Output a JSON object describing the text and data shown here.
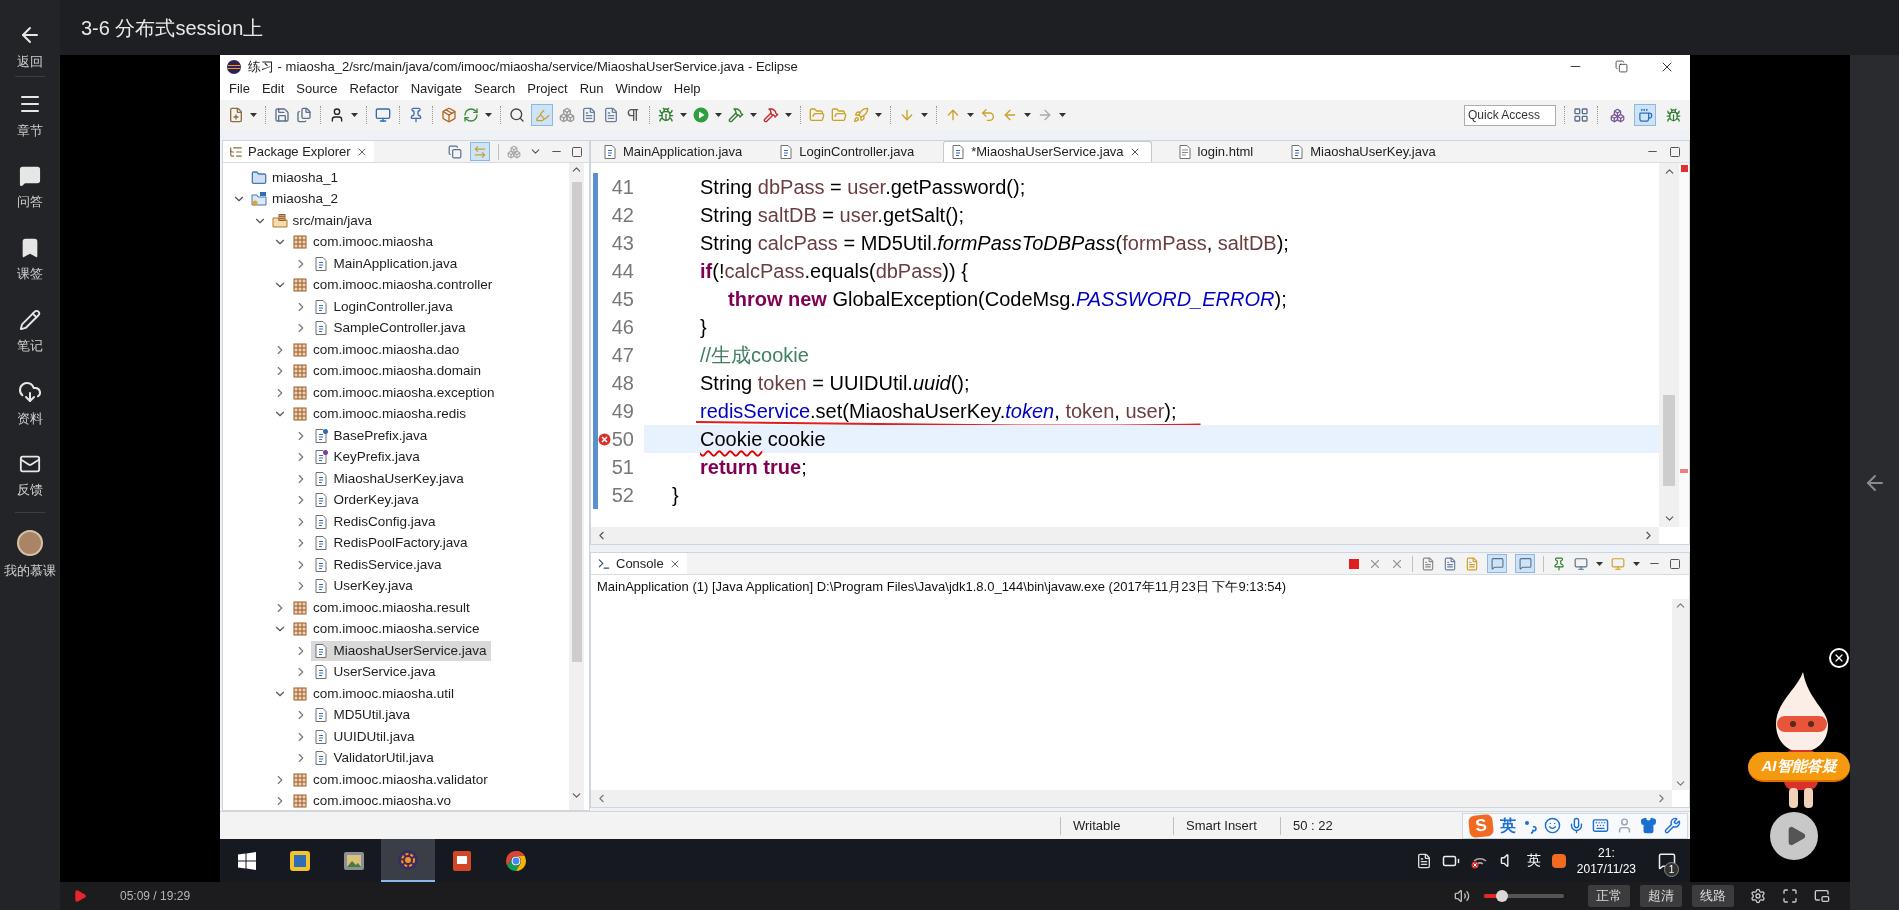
{
  "sidebar": {
    "items": [
      {
        "kind": "back",
        "label": "返回"
      },
      {
        "kind": "chapters",
        "label": "章节"
      },
      {
        "kind": "qa",
        "label": "问答"
      },
      {
        "kind": "bookmark",
        "label": "课签"
      },
      {
        "kind": "notes",
        "label": "笔记"
      },
      {
        "kind": "downloads",
        "label": "资料"
      },
      {
        "kind": "feedback",
        "label": "反馈"
      },
      {
        "kind": "profile",
        "label": "我的慕课"
      }
    ]
  },
  "header": {
    "title": "3-6 分布式session上"
  },
  "eclipse": {
    "title": "练习 - miaosha_2/src/main/java/com/imooc/miaosha/service/MiaoshaUserService.java - Eclipse",
    "menu": [
      "File",
      "Edit",
      "Source",
      "Refactor",
      "Navigate",
      "Search",
      "Project",
      "Run",
      "Window",
      "Help"
    ],
    "toolbar": {
      "mark_occurrences": true,
      "quick_access": {
        "placeholder": "Quick Access"
      },
      "perspectives": [
        {
          "kind": "java_ee",
          "selected": false
        },
        {
          "kind": "java",
          "selected": true
        },
        {
          "kind": "debug",
          "selected": false
        }
      ]
    },
    "package_explorer": {
      "title": "Package Explorer",
      "link_with_editor": true,
      "tree": [
        {
          "kind": "closed_project",
          "label": "miaosha_1",
          "selected": false
        },
        {
          "kind": "project",
          "label": "miaosha_2",
          "expanded": true,
          "selected": false,
          "children": [
            {
              "kind": "source_folder",
              "label": "src/main/java",
              "expanded": true,
              "selected": false,
              "children": [
                {
                  "kind": "package",
                  "label": "com.imooc.miaosha",
                  "expanded": true,
                  "selected": false,
                  "children": [
                    {
                      "kind": "class",
                      "label": "MainApplication.java",
                      "expanded": false,
                      "selected": false
                    }
                  ]
                },
                {
                  "kind": "package",
                  "label": "com.imooc.miaosha.controller",
                  "expanded": true,
                  "selected": false,
                  "children": [
                    {
                      "kind": "class",
                      "label": "LoginController.java",
                      "expanded": false,
                      "selected": false
                    },
                    {
                      "kind": "class",
                      "label": "SampleController.java",
                      "expanded": false,
                      "selected": false
                    }
                  ]
                },
                {
                  "kind": "package",
                  "label": "com.imooc.miaosha.dao",
                  "expanded": false,
                  "selected": false
                },
                {
                  "kind": "package",
                  "label": "com.imooc.miaosha.domain",
                  "expanded": false,
                  "selected": false
                },
                {
                  "kind": "package",
                  "label": "com.imooc.miaosha.exception",
                  "expanded": false,
                  "selected": false
                },
                {
                  "kind": "package",
                  "label": "com.imooc.miaosha.redis",
                  "expanded": true,
                  "selected": false,
                  "children": [
                    {
                      "kind": "abstract_class",
                      "label": "BasePrefix.java",
                      "expanded": false,
                      "selected": false
                    },
                    {
                      "kind": "interface",
                      "label": "KeyPrefix.java",
                      "expanded": false,
                      "selected": false
                    },
                    {
                      "kind": "class",
                      "label": "MiaoshaUserKey.java",
                      "expanded": false,
                      "selected": false
                    },
                    {
                      "kind": "class",
                      "label": "OrderKey.java",
                      "expanded": false,
                      "selected": false
                    },
                    {
                      "kind": "class",
                      "label": "RedisConfig.java",
                      "expanded": false,
                      "selected": false
                    },
                    {
                      "kind": "class",
                      "label": "RedisPoolFactory.java",
                      "expanded": false,
                      "selected": false
                    },
                    {
                      "kind": "class",
                      "label": "RedisService.java",
                      "expanded": false,
                      "selected": false
                    },
                    {
                      "kind": "class",
                      "label": "UserKey.java",
                      "expanded": false,
                      "selected": false
                    }
                  ]
                },
                {
                  "kind": "package",
                  "label": "com.imooc.miaosha.result",
                  "expanded": false,
                  "selected": false
                },
                {
                  "kind": "package",
                  "label": "com.imooc.miaosha.service",
                  "expanded": true,
                  "selected": false,
                  "children": [
                    {
                      "kind": "class",
                      "label": "MiaoshaUserService.java",
                      "expanded": false,
                      "selected": true
                    },
                    {
                      "kind": "class",
                      "label": "UserService.java",
                      "expanded": false,
                      "selected": false
                    }
                  ]
                },
                {
                  "kind": "package",
                  "label": "com.imooc.miaosha.util",
                  "expanded": true,
                  "selected": false,
                  "children": [
                    {
                      "kind": "class",
                      "label": "MD5Util.java",
                      "expanded": false,
                      "selected": false
                    },
                    {
                      "kind": "class",
                      "label": "UUIDUtil.java",
                      "expanded": false,
                      "selected": false
                    },
                    {
                      "kind": "class",
                      "label": "ValidatorUtil.java",
                      "expanded": false,
                      "selected": false
                    }
                  ]
                },
                {
                  "kind": "package",
                  "label": "com.imooc.miaosha.validator",
                  "expanded": false,
                  "selected": false
                },
                {
                  "kind": "package",
                  "label": "com.imooc.miaosha.vo",
                  "expanded": false,
                  "selected": false
                }
              ]
            }
          ]
        }
      ]
    },
    "editor": {
      "tabs": [
        {
          "kind": "java",
          "label": "MainApplication.java",
          "selected": false
        },
        {
          "kind": "java",
          "label": "LoginController.java",
          "selected": false
        },
        {
          "kind": "java",
          "label": "*MiaoshaUserService.java",
          "selected": true
        },
        {
          "kind": "html",
          "label": "login.html",
          "selected": false
        },
        {
          "kind": "java",
          "label": "MiaoshaUserKey.java",
          "selected": false
        }
      ],
      "lines": [
        {
          "number": "41",
          "current": false,
          "error": false,
          "marked": false,
          "tokens": [
            {
              "text": "\t\tString ",
              "kind": "plain"
            },
            {
              "text": "dbPass",
              "kind": "local"
            },
            {
              "text": " = ",
              "kind": "plain"
            },
            {
              "text": "user",
              "kind": "local"
            },
            {
              "text": ".getPassword();",
              "kind": "plain"
            }
          ]
        },
        {
          "number": "42",
          "current": false,
          "error": false,
          "marked": false,
          "tokens": [
            {
              "text": "\t\tString ",
              "kind": "plain"
            },
            {
              "text": "saltDB",
              "kind": "local"
            },
            {
              "text": " = ",
              "kind": "plain"
            },
            {
              "text": "user",
              "kind": "local"
            },
            {
              "text": ".getSalt();",
              "kind": "plain"
            }
          ]
        },
        {
          "number": "43",
          "current": false,
          "error": false,
          "marked": false,
          "tokens": [
            {
              "text": "\t\tString ",
              "kind": "plain"
            },
            {
              "text": "calcPass",
              "kind": "local"
            },
            {
              "text": " = MD5Util.",
              "kind": "plain"
            },
            {
              "text": "formPassToDBPass",
              "kind": "static_method"
            },
            {
              "text": "(",
              "kind": "plain"
            },
            {
              "text": "formPass",
              "kind": "local"
            },
            {
              "text": ", ",
              "kind": "plain"
            },
            {
              "text": "saltDB",
              "kind": "local"
            },
            {
              "text": ");",
              "kind": "plain"
            }
          ]
        },
        {
          "number": "44",
          "current": false,
          "error": false,
          "marked": false,
          "tokens": [
            {
              "text": "\t\tif",
              "kind": "keyword"
            },
            {
              "text": "(!",
              "kind": "plain"
            },
            {
              "text": "calcPass",
              "kind": "local"
            },
            {
              "text": ".equals(",
              "kind": "plain"
            },
            {
              "text": "dbPass",
              "kind": "local"
            },
            {
              "text": ")) {",
              "kind": "plain"
            }
          ]
        },
        {
          "number": "45",
          "current": false,
          "error": false,
          "marked": false,
          "tokens": [
            {
              "text": "\t\t\tthrow new",
              "kind": "keyword"
            },
            {
              "text": " GlobalException(CodeMsg.",
              "kind": "plain"
            },
            {
              "text": "PASSWORD_ERROR",
              "kind": "static_field"
            },
            {
              "text": ");",
              "kind": "plain"
            }
          ]
        },
        {
          "number": "46",
          "current": false,
          "error": false,
          "marked": false,
          "tokens": [
            {
              "text": "\t\t}",
              "kind": "plain"
            }
          ]
        },
        {
          "number": "47",
          "current": false,
          "error": false,
          "marked": false,
          "tokens": [
            {
              "text": "\t\t//生成cookie",
              "kind": "comment"
            }
          ]
        },
        {
          "number": "48",
          "current": false,
          "error": false,
          "marked": false,
          "tokens": [
            {
              "text": "\t\tString ",
              "kind": "plain"
            },
            {
              "text": "token",
              "kind": "local"
            },
            {
              "text": " = UUIDUtil.",
              "kind": "plain"
            },
            {
              "text": "uuid",
              "kind": "static_method"
            },
            {
              "text": "();",
              "kind": "plain"
            }
          ]
        },
        {
          "number": "49",
          "current": false,
          "error": false,
          "marked": true,
          "tokens": [
            {
              "text": "\t\tredisService",
              "kind": "field"
            },
            {
              "text": ".set(MiaoshaUserKey.",
              "kind": "plain"
            },
            {
              "text": "token",
              "kind": "static_field"
            },
            {
              "text": ", ",
              "kind": "plain"
            },
            {
              "text": "token",
              "kind": "local"
            },
            {
              "text": ", ",
              "kind": "plain"
            },
            {
              "text": "user",
              "kind": "local"
            },
            {
              "text": ");",
              "kind": "plain"
            }
          ]
        },
        {
          "number": "50",
          "current": true,
          "error": true,
          "marked": false,
          "tokens": [
            {
              "text": "\t\tCookie",
              "kind": "error"
            },
            {
              "text": " cookie",
              "kind": "plain"
            }
          ]
        },
        {
          "number": "51",
          "current": false,
          "error": false,
          "marked": false,
          "tokens": [
            {
              "text": "\t\treturn true",
              "kind": "keyword"
            },
            {
              "text": ";",
              "kind": "plain"
            }
          ]
        },
        {
          "number": "52",
          "current": false,
          "error": false,
          "marked": false,
          "tokens": [
            {
              "text": "\t}",
              "kind": "plain"
            }
          ]
        }
      ]
    },
    "console": {
      "title": "Console",
      "show_on_stdout": true,
      "show_on_stderr": true,
      "launch_info": "MainApplication (1) [Java Application] D:\\Program Files\\Java\\jdk1.8.0_144\\bin\\javaw.exe (2017年11月23日 下午9:13:54)"
    },
    "status_bar": {
      "items": [
        "Writable",
        "Smart Insert",
        "50 : 22"
      ]
    },
    "ime_bar": {
      "logo": "S",
      "mode": "英"
    }
  },
  "taskbar": {
    "apps": [
      {
        "kind": "files",
        "selected": false
      },
      {
        "kind": "viewer",
        "selected": false
      },
      {
        "kind": "ide",
        "selected": true
      },
      {
        "kind": "slides",
        "selected": false
      },
      {
        "kind": "browser",
        "selected": false
      }
    ],
    "tray": {
      "input": "英",
      "time": "21:",
      "date": "2017/11/23",
      "badge": "1"
    }
  },
  "player": {
    "time": "05:09 / 19:29",
    "volume": {
      "level": 0.23
    },
    "buttons": [
      "正常",
      "超清",
      "线路"
    ],
    "assistant": {
      "label": "AI智能答疑"
    }
  }
}
